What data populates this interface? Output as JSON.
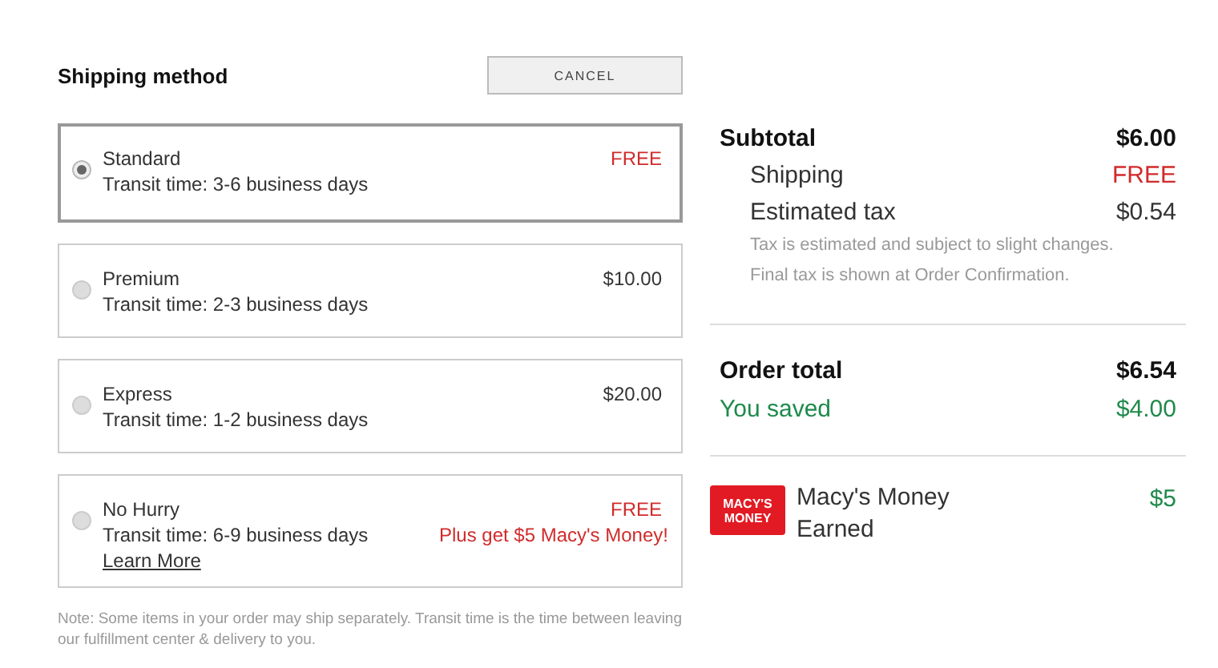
{
  "shipping": {
    "title": "Shipping method",
    "cancel_button": "CANCEL",
    "options": [
      {
        "name": "Standard",
        "transit": "Transit time: 3-6 business days",
        "selected": true,
        "price": {
          "text": "FREE",
          "kind": "free"
        }
      },
      {
        "name": "Premium",
        "transit": "Transit time: 2-3 business days",
        "selected": false,
        "price": {
          "text": "$10.00",
          "kind": "paid"
        }
      },
      {
        "name": "Express",
        "transit": "Transit time: 1-2 business days",
        "selected": false,
        "price": {
          "text": "$20.00",
          "kind": "paid"
        }
      },
      {
        "name": "No Hurry",
        "transit": "Transit time: 6-9 business days",
        "selected": false,
        "price": {
          "text": "FREE",
          "kind": "free"
        },
        "promo": "Plus get $5 Macy's Money!",
        "link": "Learn More"
      }
    ],
    "note": "Note: Some items in your order may ship separately. Transit time is the time between leaving our fulfillment center & delivery to you."
  },
  "summary": {
    "subtotal": {
      "label": "Subtotal",
      "value": "$6.00"
    },
    "lines": [
      {
        "label": "Shipping",
        "value": "FREE",
        "kind": "free"
      },
      {
        "label": "Estimated tax",
        "value": "$0.54",
        "kind": "paid"
      }
    ],
    "tax_note": [
      "Tax is estimated and subject to slight changes.",
      "Final tax is shown at Order Confirmation."
    ],
    "total": {
      "label": "Order total",
      "value": "$6.54"
    },
    "saved": {
      "label": "You saved",
      "value": "$4.00"
    },
    "reward": {
      "logo": [
        "MACY'S",
        "MONEY"
      ],
      "label": [
        "Macy's Money",
        "Earned"
      ],
      "value": "$5"
    }
  }
}
